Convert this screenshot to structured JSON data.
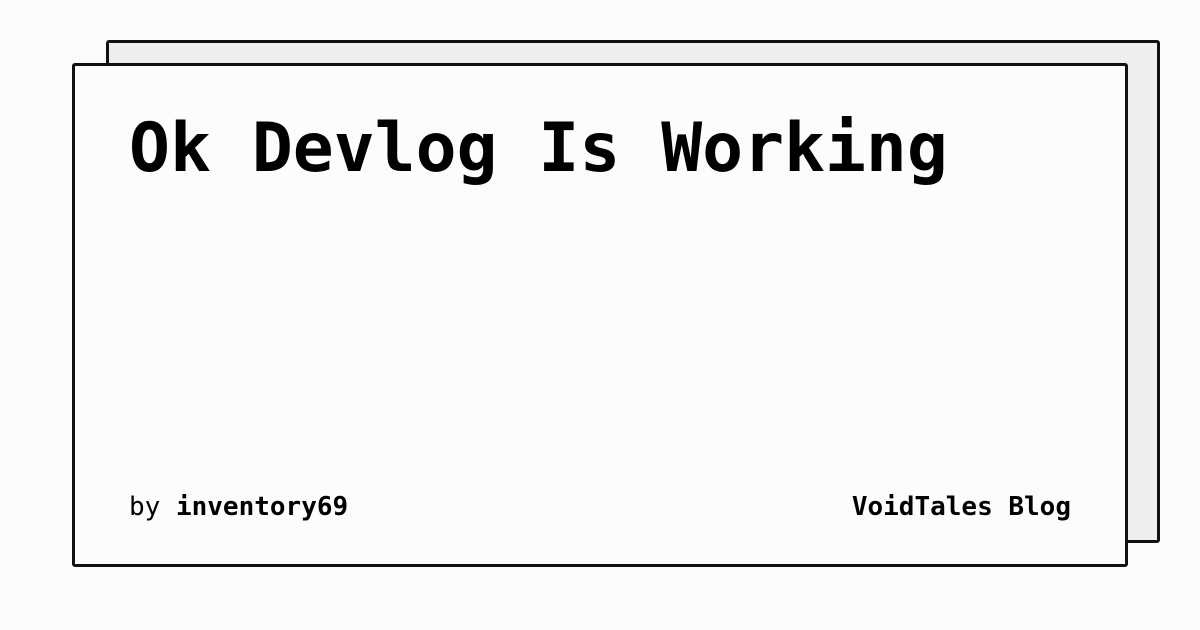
{
  "post": {
    "title": "Ok Devlog Is Working",
    "by_prefix": "by",
    "author": "inventory69"
  },
  "blog": {
    "name": "VoidTales Blog"
  },
  "colors": {
    "background": "#fdfcfa",
    "card_back": "#eeeeee",
    "border": "#111111",
    "text": "#000000"
  }
}
